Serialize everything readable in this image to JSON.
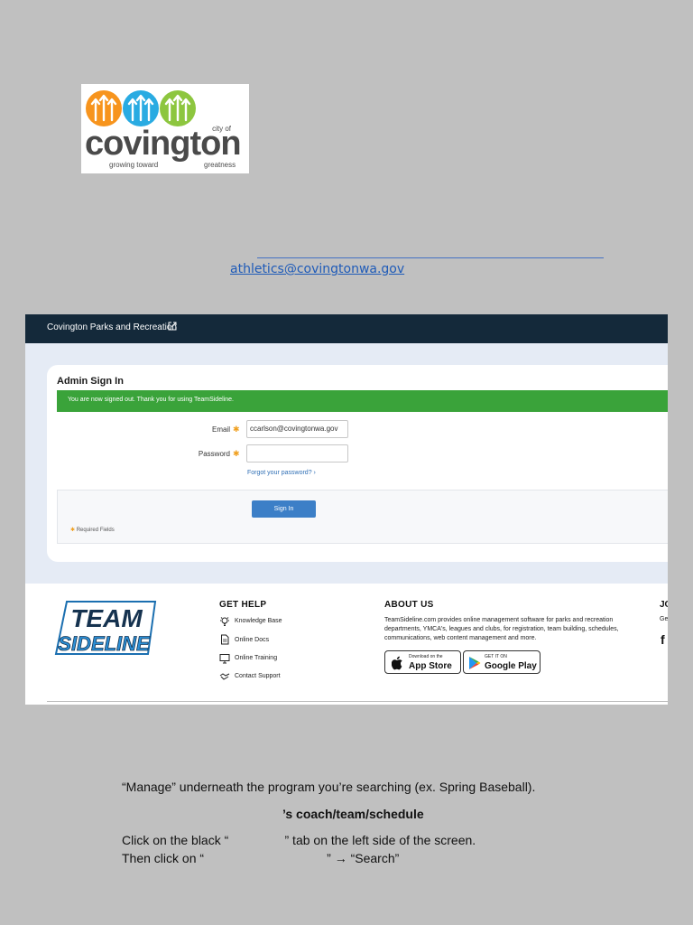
{
  "logo": {
    "word": "covington",
    "city_of": "city of",
    "tagline_left": "growing toward",
    "tagline_right": "greatness",
    "colors": [
      "#f7941d",
      "#29abe2",
      "#8dc63f"
    ]
  },
  "contact_email": "athletics@covingtonwa.gov",
  "screenshot": {
    "site_name": "Covington Parks and Recreation",
    "external_link_icon": "external-link-icon",
    "card_title": "Admin Sign In",
    "alert_text": "You are now signed out. Thank you for using TeamSideline.",
    "email_label": "Email",
    "email_value": "ccarlson@covingtonwa.gov",
    "password_label": "Password",
    "password_value": "",
    "required_star": "✱",
    "forgot_link": "Forgot your password? ›",
    "sign_in_button": "Sign In",
    "required_fields": "Required Fields"
  },
  "footer": {
    "brand_line1": "TEAM",
    "brand_line2": "SIDELINE",
    "get_help_heading": "GET HELP",
    "help_items": [
      "Knowledge Base",
      "Online Docs",
      "Online Training",
      "Contact Support"
    ],
    "about_heading": "ABOUT US",
    "about_text": "TeamSideline.com provides online management software for parks and recreation departments, YMCA's, leagues and clubs, for registration, team building, schedules, communications, web content management and more.",
    "app_store_small": "Download on the",
    "app_store_big": "App Store",
    "google_play_small": "GET IT ON",
    "google_play_big": "Google Play",
    "third_col_heading": "JO",
    "third_col_text": "Ge",
    "facebook_glyph": "f"
  },
  "instructions": {
    "line1": "“Manage” underneath the program you’re searching (ex. Spring Baseball).",
    "line2": "’s coach/team/schedule",
    "line3": "Click on the black “                ” tab on the left side of the screen.",
    "line4": "Then click on “                                   ” → “Search”"
  }
}
